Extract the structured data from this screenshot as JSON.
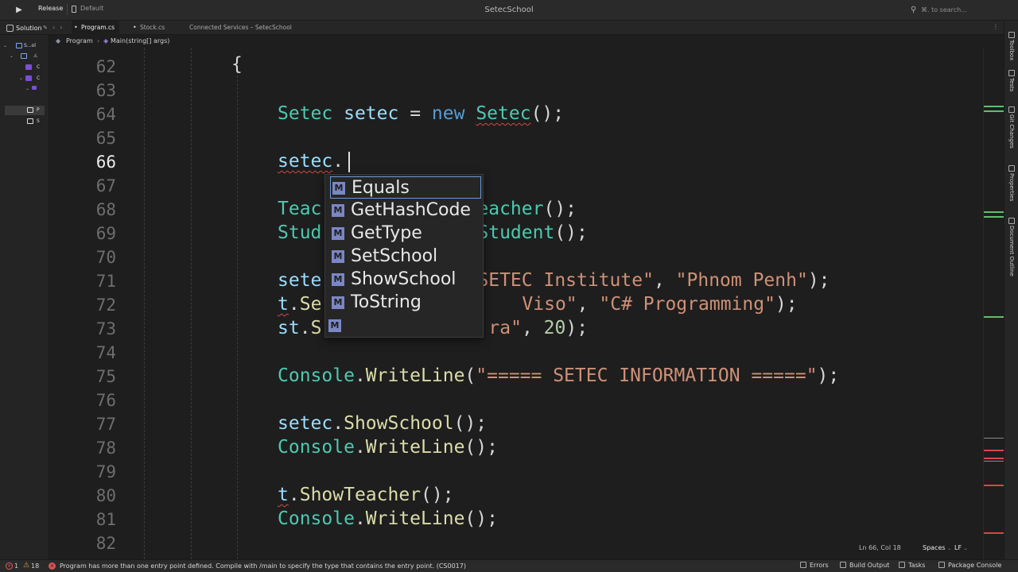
{
  "titlebar": {
    "configuration": "Release",
    "target": "Default",
    "app_title": "SetecSchool",
    "search_placeholder": "⌘. to search..."
  },
  "tabs": {
    "solution_label": "Solution",
    "items": [
      {
        "label": "Program.cs",
        "active": true
      },
      {
        "label": "Stock.cs",
        "active": false
      },
      {
        "label": "Connected Services – SetecSchool",
        "active": false
      }
    ]
  },
  "explorer": {
    "items": [
      {
        "label": "S...ol"
      },
      {
        "label": "C"
      },
      {
        "label": "C"
      },
      {
        "label": "P"
      },
      {
        "label": "S"
      }
    ]
  },
  "breadcrumb": {
    "class_name": "Program",
    "method_name": "Main(string[] args)"
  },
  "editor": {
    "line_numbers": [
      "62",
      "63",
      "64",
      "65",
      "66",
      "67",
      "68",
      "69",
      "70",
      "71",
      "72",
      "73",
      "74",
      "75",
      "76",
      "77",
      "78",
      "79",
      "80",
      "81",
      "82"
    ],
    "current_line": "66",
    "code": {
      "l62": "{",
      "l64": {
        "type": "Setec",
        "var": "setec",
        "eq": " = ",
        "kw": "new",
        "ctor": "Setec",
        "tail": "();"
      },
      "l66": {
        "obj": "setec",
        "dot": "."
      },
      "l68": {
        "head": "Teac",
        "ctor": "eacher",
        "tail": "();"
      },
      "l69": {
        "head": "Stud",
        "ctor": "Student",
        "tail": "();"
      },
      "l71": {
        "head": "sete",
        "str1": "SETEC Institute\"",
        "comma": ", ",
        "str2": "\"Phnom Penh\"",
        "tail": ");"
      },
      "l72": {
        "obj": "t",
        "dot": ".",
        "head": "Se",
        "str1": "Viso\"",
        "comma": ", ",
        "str2": "\"C# Programming\"",
        "tail": ");"
      },
      "l73": {
        "obj": "st",
        "dot": ".",
        "head": "S",
        "str1": "ra\"",
        "comma": ", ",
        "num": "20",
        "tail": ");"
      },
      "l75": {
        "type": "Console",
        "dot": ".",
        "method": "WriteLine",
        "open": "(",
        "str": "\"===== SETEC INFORMATION =====\"",
        "tail": ");"
      },
      "l77": {
        "obj": "setec",
        "dot": ".",
        "method": "ShowSchool",
        "tail": "();"
      },
      "l78": {
        "type": "Console",
        "dot": ".",
        "method": "WriteLine",
        "tail": "();"
      },
      "l80": {
        "obj": "t",
        "dot": ".",
        "method": "ShowTeacher",
        "tail": "();"
      },
      "l81": {
        "type": "Console",
        "dot": ".",
        "method": "WriteLine",
        "tail": "();"
      }
    }
  },
  "completion": {
    "badge": "M",
    "items": [
      "Equals",
      "GetHashCode",
      "GetType",
      "SetSchool",
      "ShowSchool",
      "ToString",
      ""
    ],
    "selected_index": 0
  },
  "toolstrip": {
    "items": [
      "Toolbox",
      "Tests",
      "Git Changes",
      "Properties",
      "Document Outline"
    ]
  },
  "editor_status": {
    "position": "Ln 66, Col 18",
    "indentation": "Spaces",
    "line_ending": "LF"
  },
  "statusbar": {
    "error_count": "1",
    "warning_count": "18",
    "message": "Program has more than one entry point defined. Compile with /main to specify the type that contains the entry point. (CS0017)",
    "errors_label": "Errors",
    "build_output_label": "Build Output",
    "tasks_label": "Tasks",
    "package_console_label": "Package Console"
  },
  "colors": {
    "background": "#1e1e1e",
    "type": "#4ec9b0",
    "keyword": "#569cd6",
    "identifier": "#9cdcfe",
    "string": "#ce9178",
    "number": "#b5cea8",
    "method": "#dcdcaa",
    "error": "#d9534f",
    "warning": "#e2a53a"
  },
  "icons": {
    "run": "play-icon",
    "search": "magnifier-icon",
    "completion_item": "method-icon"
  }
}
